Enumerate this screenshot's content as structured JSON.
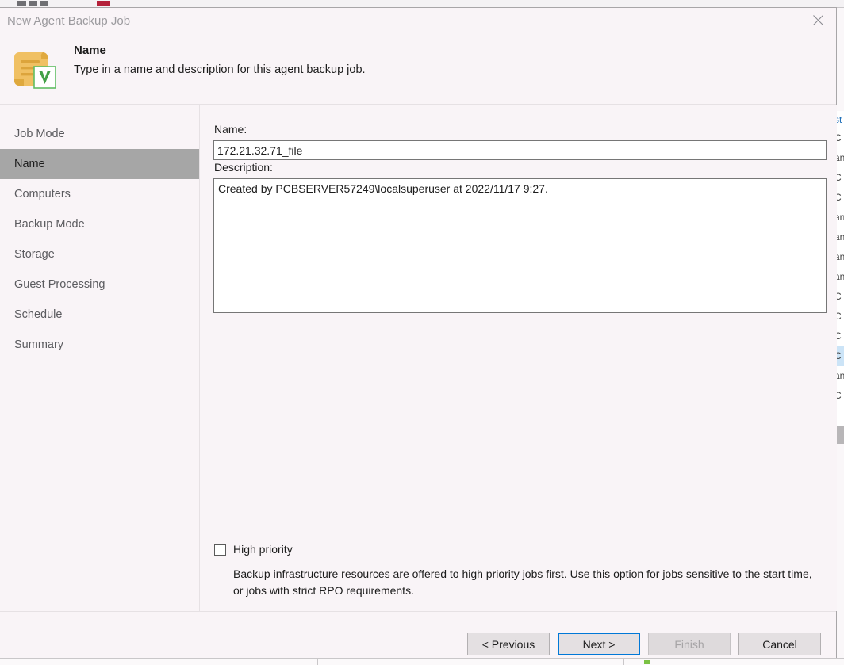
{
  "window": {
    "title": "New Agent Backup Job",
    "close_icon": "close-icon"
  },
  "header": {
    "icon": "backup-job-scroll-veeam-icon",
    "title": "Name",
    "subtitle": "Type in a name and description for this agent backup job."
  },
  "sidebar": {
    "items": [
      {
        "label": "Job Mode",
        "active": false
      },
      {
        "label": "Name",
        "active": true
      },
      {
        "label": "Computers",
        "active": false
      },
      {
        "label": "Backup Mode",
        "active": false
      },
      {
        "label": "Storage",
        "active": false
      },
      {
        "label": "Guest Processing",
        "active": false
      },
      {
        "label": "Schedule",
        "active": false
      },
      {
        "label": "Summary",
        "active": false
      }
    ]
  },
  "form": {
    "name_label": "Name:",
    "name_value": "172.21.32.71_file",
    "description_label": "Description:",
    "description_value": "Created by PCBSERVER57249\\localsuperuser at 2022/11/17 9:27.",
    "high_priority_label": "High priority",
    "high_priority_checked": false,
    "high_priority_description": "Backup infrastructure resources are offered to high priority jobs first. Use this option for jobs sensitive to the start time, or jobs with strict RPO requirements."
  },
  "footer": {
    "previous_label": "< Previous",
    "next_label": "Next >",
    "finish_label": "Finish",
    "cancel_label": "Cancel",
    "finish_enabled": false,
    "next_focused": true
  },
  "background": {
    "list_rows": [
      {
        "text": "st",
        "header": true,
        "selected": false
      },
      {
        "text": "C",
        "header": false,
        "selected": false
      },
      {
        "text": "an",
        "header": false,
        "selected": false
      },
      {
        "text": "C",
        "header": false,
        "selected": false
      },
      {
        "text": "C",
        "header": false,
        "selected": false
      },
      {
        "text": "an",
        "header": false,
        "selected": false
      },
      {
        "text": "an",
        "header": false,
        "selected": false
      },
      {
        "text": "an",
        "header": false,
        "selected": false
      },
      {
        "text": "an",
        "header": false,
        "selected": false
      },
      {
        "text": "C",
        "header": false,
        "selected": false
      },
      {
        "text": "C",
        "header": false,
        "selected": false
      },
      {
        "text": "C",
        "header": false,
        "selected": false
      },
      {
        "text": "C",
        "header": false,
        "selected": true
      },
      {
        "text": "an",
        "header": false,
        "selected": false
      },
      {
        "text": "C",
        "header": false,
        "selected": false
      }
    ]
  },
  "colors": {
    "dialog_background": "#f9f4f7",
    "sidebar_active": "#a6a6a6",
    "focus_blue": "#0078d7",
    "icon_paper": "#f0c063",
    "icon_green": "#4caf50",
    "title_gray": "#9b9a9e"
  }
}
